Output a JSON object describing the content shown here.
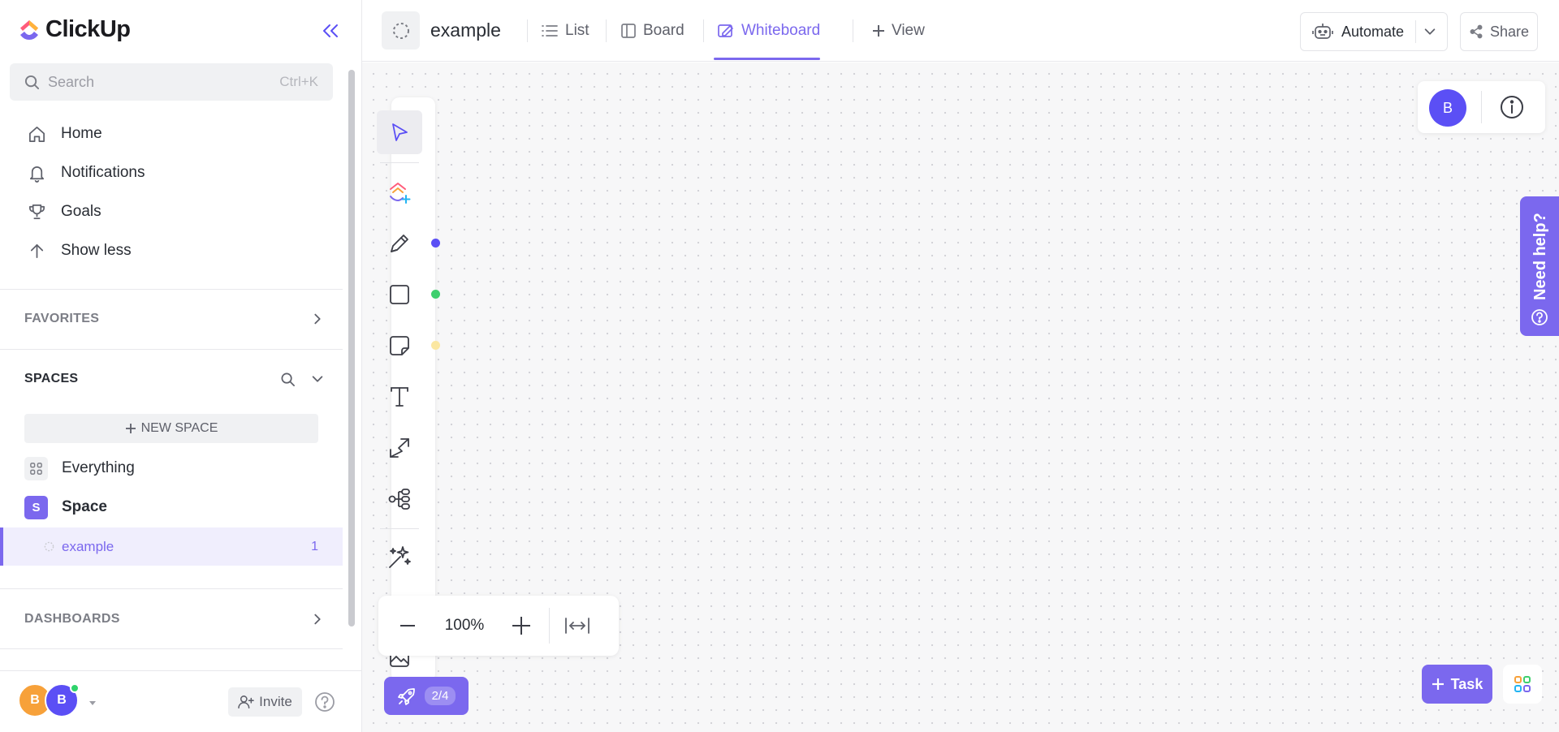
{
  "app": {
    "name": "ClickUp"
  },
  "sidebar": {
    "search": {
      "placeholder": "Search",
      "shortcut": "Ctrl+K"
    },
    "nav": [
      {
        "label": "Home",
        "icon": "home-icon"
      },
      {
        "label": "Notifications",
        "icon": "bell-icon"
      },
      {
        "label": "Goals",
        "icon": "trophy-icon"
      },
      {
        "label": "Show less",
        "icon": "arrow-up-icon"
      }
    ],
    "favorites": {
      "title": "FAVORITES"
    },
    "spaces": {
      "title": "SPACES",
      "new_space": "NEW SPACE",
      "everything": "Everything",
      "space": {
        "name": "Space",
        "initial": "S",
        "color": "#7b68ee"
      },
      "list": {
        "name": "example",
        "count": "1"
      }
    },
    "dashboards": {
      "title": "DASHBOARDS"
    },
    "footer": {
      "avatars": [
        {
          "initial": "B",
          "color": "#f7a13a"
        },
        {
          "initial": "B",
          "color": "#5b4ff5"
        }
      ],
      "invite": "Invite"
    }
  },
  "topbar": {
    "list_name": "example",
    "tabs": [
      {
        "label": "List",
        "icon": "list-icon"
      },
      {
        "label": "Board",
        "icon": "board-icon"
      },
      {
        "label": "Whiteboard",
        "icon": "whiteboard-icon",
        "active": true
      }
    ],
    "add_view": "View",
    "automate": "Automate",
    "share": "Share"
  },
  "canvas": {
    "zoom": "100%",
    "onboarding_progress": "2/4",
    "collaborator_initial": "B",
    "help": "Need help?",
    "task_button": "Task",
    "tool_colors": {
      "pen": "#5b4ff5",
      "shape": "#3ecf6e",
      "sticky": "#fbe7a1"
    },
    "accent": "#7b68ee"
  }
}
